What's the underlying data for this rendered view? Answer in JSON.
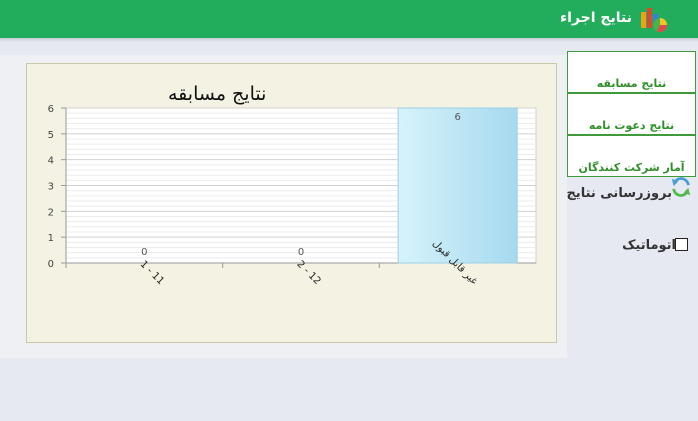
{
  "header": {
    "title": "نتایج اجراء",
    "icon": "chart-app-icon"
  },
  "tabs": [
    {
      "label": "نتایج مسابقه"
    },
    {
      "label": "نتایج دعوت نامه"
    },
    {
      "label": "آمار شرکت کنندگان"
    }
  ],
  "actions": {
    "refresh_label": "بروزرسانی نتایج",
    "auto_label": "اتوماتیک",
    "auto_checked": false
  },
  "colors": {
    "header_bg": "#22ad5c",
    "tab_border": "#3e9a3a",
    "bar_fill": "#bfeaf6"
  },
  "chart_data": {
    "type": "bar",
    "title": "نتایج مسابقه",
    "categories": [
      "1 - 11",
      "2 - 12",
      "غیر قابل قبول"
    ],
    "values": [
      0,
      0,
      6
    ],
    "data_labels": [
      "0",
      "0",
      "6"
    ],
    "ylim": [
      0,
      6
    ],
    "yticks": [
      0,
      1,
      2,
      3,
      4,
      5,
      6
    ],
    "grid": true,
    "xlabel": "",
    "ylabel": ""
  }
}
